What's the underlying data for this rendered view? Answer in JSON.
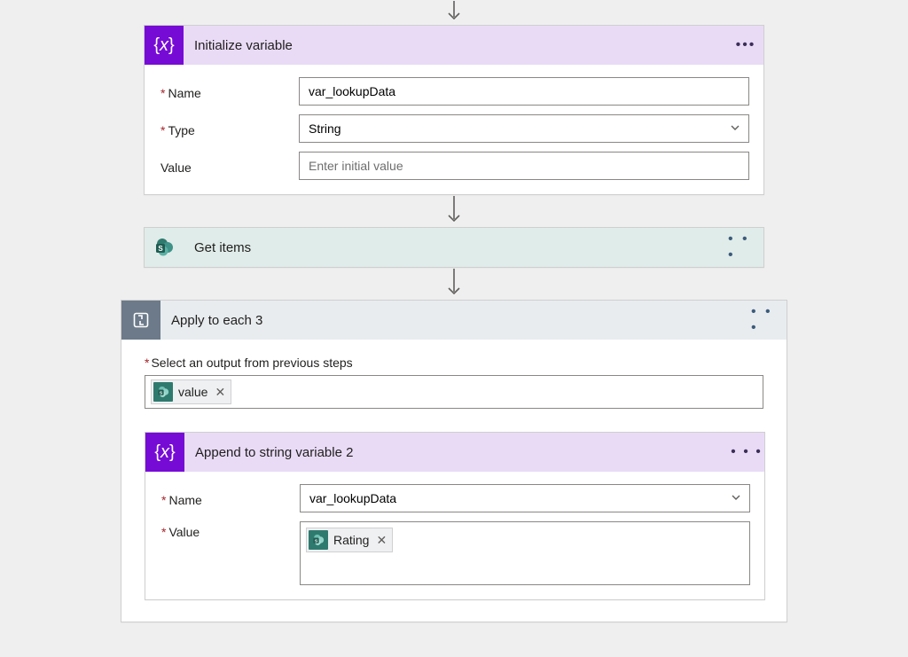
{
  "init_var": {
    "title": "Initialize variable",
    "name_label": "Name",
    "name_value": "var_lookupData",
    "type_label": "Type",
    "type_value": "String",
    "value_label": "Value",
    "value_placeholder": "Enter initial value"
  },
  "get_items": {
    "title": "Get items"
  },
  "apply_each": {
    "title": "Apply to each 3",
    "select_label": "Select an output from previous steps",
    "output_token": "value"
  },
  "append": {
    "title": "Append to string variable 2",
    "name_label": "Name",
    "name_value": "var_lookupData",
    "value_label": "Value",
    "value_token": "Rating"
  }
}
